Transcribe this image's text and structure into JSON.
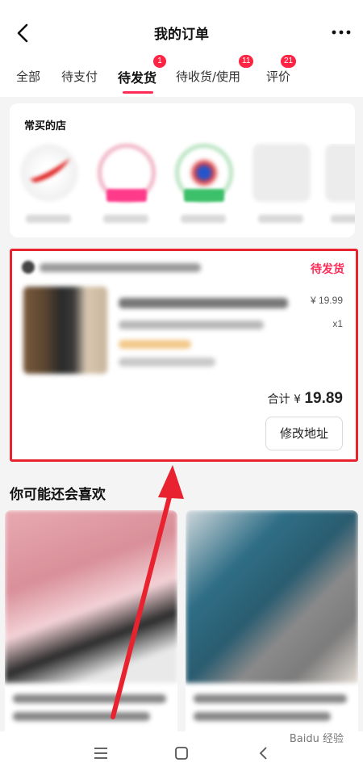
{
  "header": {
    "title": "我的订单",
    "back_icon": "chevron-left-icon",
    "more_icon": "ellipsis-icon"
  },
  "tabs": [
    {
      "label": "全部",
      "active": false,
      "badge": ""
    },
    {
      "label": "待支付",
      "active": false,
      "badge": ""
    },
    {
      "label": "待发货",
      "active": true,
      "badge": "1"
    },
    {
      "label": "待收货/使用",
      "active": false,
      "badge": "11"
    },
    {
      "label": "评价",
      "active": false,
      "badge": "21"
    }
  ],
  "frequent_stores": {
    "title": "常买的店"
  },
  "order": {
    "status": "待发货",
    "price": "¥ 19.99",
    "quantity": "x1",
    "total_label": "合计 ¥ ",
    "total_value": "19.89",
    "action_label": "修改地址"
  },
  "recommend": {
    "title": "你可能还会喜欢"
  },
  "nav": {
    "menu_icon": "menu-icon",
    "home_icon": "square-icon",
    "back_icon": "triangle-back-icon"
  },
  "watermark": "Baidu 经验",
  "colors": {
    "accent": "#ff2a55",
    "badge": "#ff2344",
    "highlight_box": "#e8232f"
  }
}
